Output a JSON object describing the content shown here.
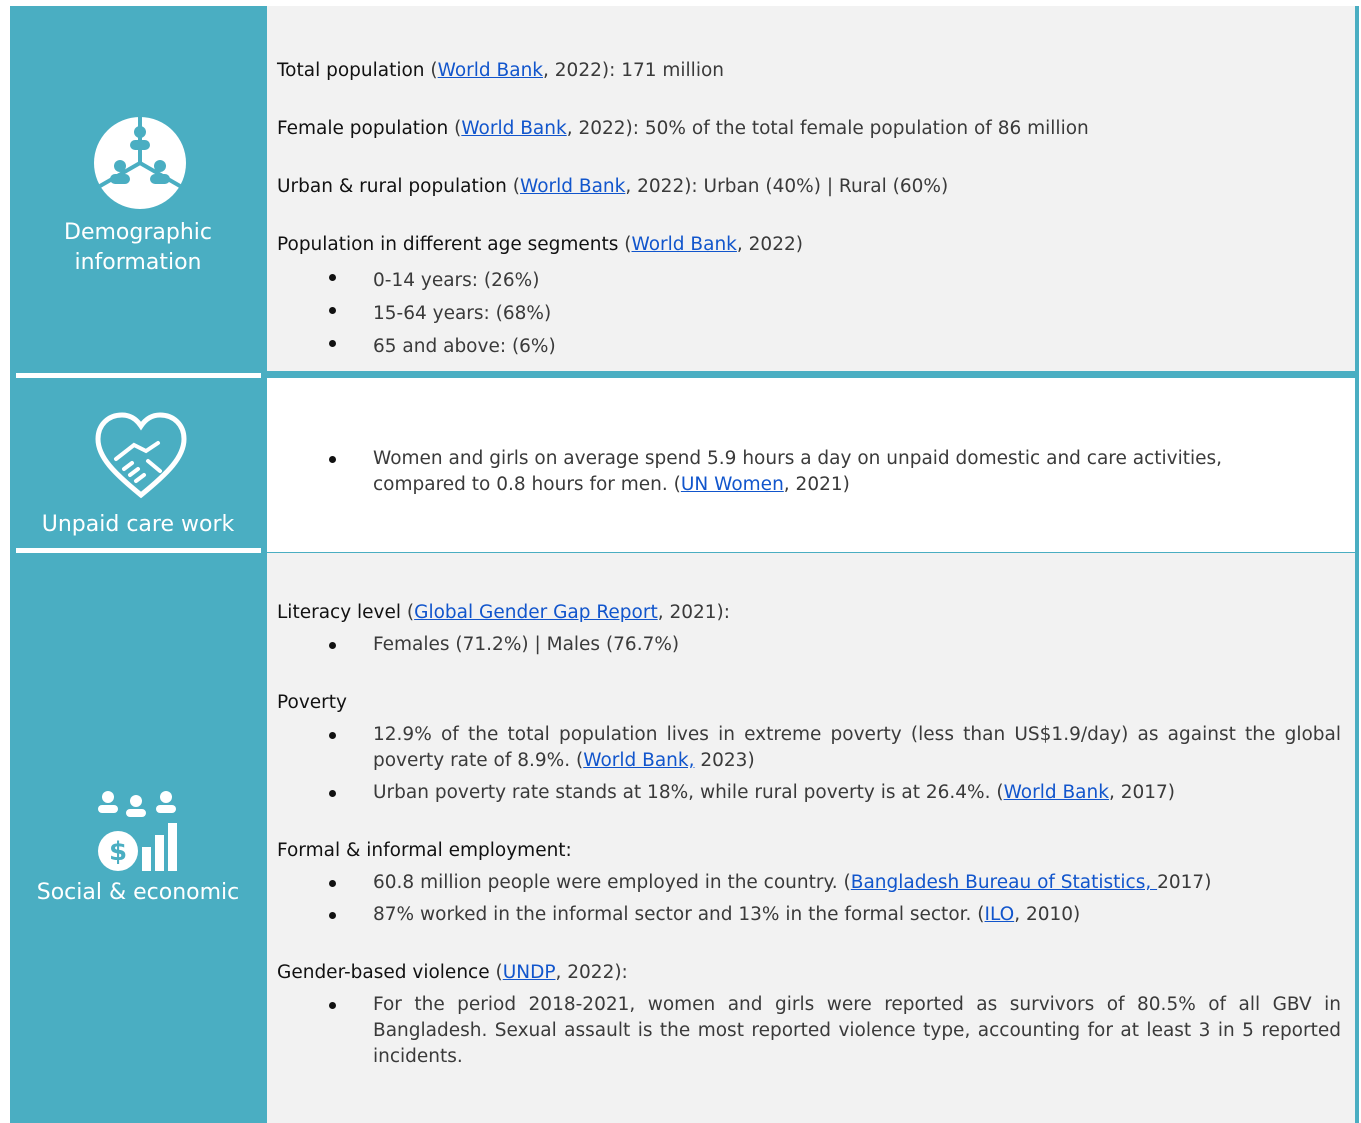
{
  "sections": [
    {
      "title_lines": [
        "Demographic",
        "information"
      ],
      "icon": "demographic-people-icon",
      "items": {
        "total": {
          "label": "Total population",
          "open": " (",
          "link": "World Bank",
          "tail": ", 2022): 171 million"
        },
        "female": {
          "label": "Female population",
          "open": " (",
          "link": "World Bank",
          "tail": ", 2022): 50% of the total female population of 86 million"
        },
        "urban": {
          "label": "Urban & rural population",
          "open": " (",
          "link": "World Bank",
          "tail": ", 2022): Urban (40%) | Rural (60%)"
        },
        "age": {
          "label": "Population in different age segments",
          "open": " (",
          "link": "World Bank",
          "tail": ", 2022)",
          "bullets": [
            "0-14 years: (26%)",
            "15-64 years: (68%)",
            "65 and above: (6%)"
          ]
        }
      }
    },
    {
      "title": "Unpaid care work",
      "icon": "heart-handshake-icon",
      "bullet": {
        "text_a": "Women and girls on average spend 5.9 hours a day on unpaid domestic and care activities,",
        "text_b": "compared to 0.8 hours for men. (",
        "link": "UN Women",
        "tail": ", 2021)"
      }
    },
    {
      "title": "Social & economic",
      "icon": "people-money-chart-icon",
      "literacy": {
        "label": "Literacy level",
        "open": " (",
        "link": "Global Gender Gap Report",
        "tail": ", 2021):",
        "bullet": "Females (71.2%) | Males (76.7%)"
      },
      "poverty": {
        "label": "Poverty",
        "b1_text": "12.9% of the total population lives in extreme poverty (less than US$1.9/day) as against the global poverty rate of 8.9%. (",
        "b1_link": "World Bank,",
        "b1_tail": " 2023)",
        "b2_text": "Urban poverty rate stands at 18%, while rural poverty is at 26.4%. (",
        "b2_link": "World Bank",
        "b2_tail": ", 2017)"
      },
      "employment": {
        "label": "Formal & informal employment:",
        "b1_text": "60.8 million people were employed in the country. (",
        "b1_link": "Bangladesh Bureau of Statistics, ",
        "b1_tail": "2017)",
        "b2_text": "87% worked in the informal sector and 13% in the formal sector. (",
        "b2_link": "ILO",
        "b2_tail": ", 2010)"
      },
      "gbv": {
        "label": "Gender-based violence",
        "open": " (",
        "link": "UNDP",
        "tail": ", 2022):",
        "bullet": "For the period 2018-2021, women and girls were reported as survivors of 80.5% of all GBV in Bangladesh. Sexual assault is the most reported violence type, accounting for at least 3 in 5 reported incidents."
      }
    }
  ],
  "colors": {
    "teal": "#4aaec2",
    "panel_gray": "#f2f2f2",
    "link": "#1155cc"
  }
}
